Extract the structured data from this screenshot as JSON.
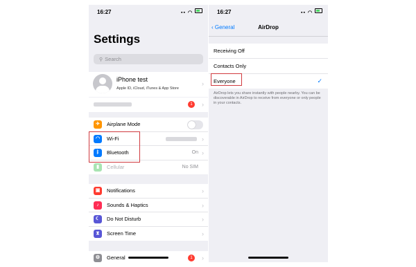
{
  "left": {
    "time": "16:27",
    "title": "Settings",
    "search_placeholder": "Search",
    "profile": {
      "name": "iPhone test",
      "subtitle": "Apple ID, iCloud, iTunes & App Store"
    },
    "notice_badge": "1",
    "connectivity": [
      {
        "label": "Airplane Mode",
        "icon": "airplane-icon",
        "color": "#ff9500",
        "value": ""
      },
      {
        "label": "Wi-Fi",
        "icon": "wifi-icon",
        "color": "#007aff",
        "value": ""
      },
      {
        "label": "Bluetooth",
        "icon": "bluetooth-icon",
        "color": "#007aff",
        "value": "On"
      },
      {
        "label": "Cellular",
        "icon": "cellular-icon",
        "color": "#4cd964",
        "value": "No SIM"
      }
    ],
    "system": [
      {
        "label": "Notifications",
        "icon": "notifications-icon",
        "color": "#ff3b30"
      },
      {
        "label": "Sounds & Haptics",
        "icon": "sounds-icon",
        "color": "#ff2d55"
      },
      {
        "label": "Do Not Disturb",
        "icon": "moon-icon",
        "color": "#5856d6"
      },
      {
        "label": "Screen Time",
        "icon": "hourglass-icon",
        "color": "#5856d6"
      }
    ],
    "general": {
      "label": "General",
      "icon": "gear-icon",
      "color": "#8e8e93",
      "badge": "1"
    }
  },
  "right": {
    "time": "16:27",
    "back_label": "General",
    "title": "AirDrop",
    "options": [
      "Receiving Off",
      "Contacts Only",
      "Everyone"
    ],
    "selected": "Everyone",
    "description": "AirDrop lets you share instantly with people nearby. You can be discoverable in AirDrop to receive from everyone or only people in your contacts."
  }
}
